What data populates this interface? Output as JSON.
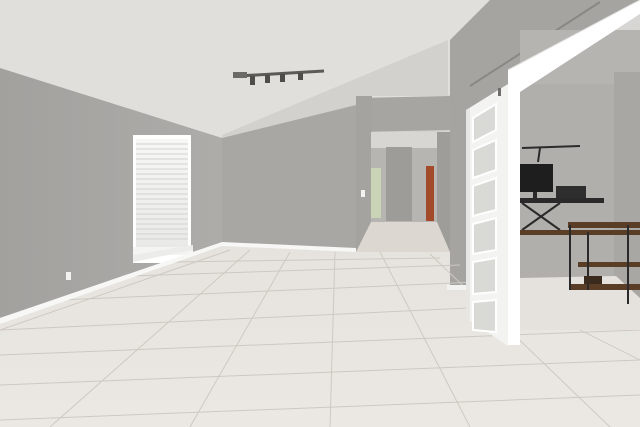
{
  "scene": {
    "subject": "empty-room-interior",
    "elements": [
      "vaulted-ceiling",
      "track-light",
      "window-with-blinds",
      "hallway-opening",
      "sliding-barn-door",
      "office-desk",
      "monitor",
      "tile-floor"
    ]
  },
  "colors": {
    "wall": "#a8a6a3",
    "wall_shadow": "#9c9a97",
    "ceiling": "#dcdbd9",
    "floor": "#e4e1dc",
    "grout": "#c9c5be",
    "door": "#f4f4f2",
    "trim": "#ffffff",
    "wood": "#5a3d26"
  }
}
